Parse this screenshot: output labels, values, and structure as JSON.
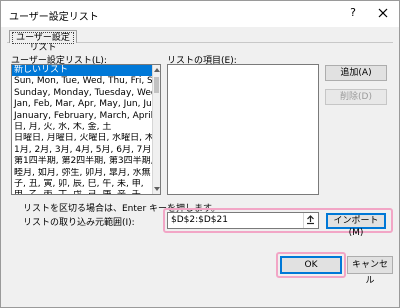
{
  "window": {
    "title": "ユーザー設定リスト",
    "help_label": "?",
    "close_label": "×"
  },
  "tab": {
    "label": "ユーザー設定リスト"
  },
  "custom_lists": {
    "label": "ユーザー設定リスト(L):",
    "items": [
      "新しいリスト",
      "Sun, Mon, Tue, Wed, Thu, Fri, Sa",
      "Sunday, Monday, Tuesday, Wedn",
      "Jan, Feb, Mar, Apr, May, Jun, Jul,",
      "January, February, March, April,",
      "日, 月, 火, 水, 木, 金, 土",
      "日曜日, 月曜日, 火曜日, 水曜日, 木",
      "1月, 2月, 3月, 4月, 5月, 6月, 7月, 8",
      "第1四半期, 第2四半期, 第3四半期,",
      "睦月, 如月, 弥生, 卯月, 皐月, 水無",
      "子, 丑, 寅, 卯, 辰, 巳, 午, 未, 申,",
      "甲, 乙, 丙, 丁, 戊, 己, 庚, 辛, 壬,"
    ]
  },
  "list_entries": {
    "label": "リストの項目(E):"
  },
  "buttons": {
    "add": "追加(A)",
    "delete": "削除(D)",
    "import": "インポート(M)",
    "ok": "OK",
    "cancel": "キャンセル"
  },
  "hint": "リストを区切る場合は、Enter キーを押します。",
  "import_range": {
    "label": "リストの取り込み元範囲(I):",
    "value": "$D$2:$D$21"
  },
  "highlight_color": "#f2a6c6",
  "selection_color": "#0078d7"
}
